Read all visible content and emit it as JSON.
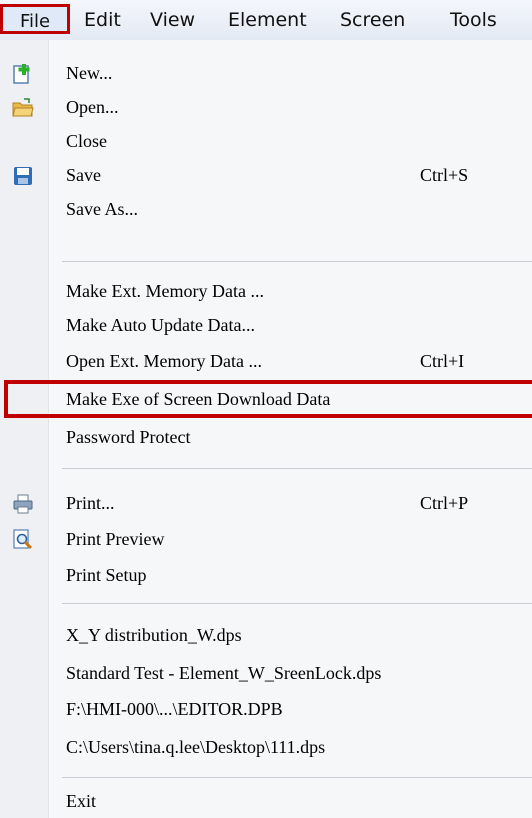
{
  "menubar": {
    "items": [
      {
        "label": "File"
      },
      {
        "label": "Edit"
      },
      {
        "label": "View"
      },
      {
        "label": "Element"
      },
      {
        "label": "Screen"
      },
      {
        "label": "Tools"
      }
    ]
  },
  "menu": {
    "items": [
      {
        "label": "New...",
        "shortcut": "",
        "icon": "new-file-icon"
      },
      {
        "label": "Open...",
        "shortcut": "",
        "icon": "open-folder-icon"
      },
      {
        "label": "Close",
        "shortcut": ""
      },
      {
        "label": "Save",
        "shortcut": "Ctrl+S",
        "icon": "save-icon"
      },
      {
        "label": "Save As...",
        "shortcut": ""
      },
      {
        "label": "Make Ext. Memory Data ...",
        "shortcut": ""
      },
      {
        "label": "Make Auto Update Data...",
        "shortcut": ""
      },
      {
        "label": "Open Ext. Memory Data ...",
        "shortcut": "Ctrl+I"
      },
      {
        "label": "Make Exe of Screen Download Data",
        "shortcut": ""
      },
      {
        "label": "Password Protect",
        "shortcut": ""
      },
      {
        "label": "Print...",
        "shortcut": "Ctrl+P",
        "icon": "printer-icon"
      },
      {
        "label": "Print Preview",
        "shortcut": "",
        "icon": "print-preview-icon"
      },
      {
        "label": "Print Setup",
        "shortcut": ""
      },
      {
        "label": "X_Y distribution_W.dps",
        "shortcut": ""
      },
      {
        "label": "Standard Test - Element_W_SreenLock.dps",
        "shortcut": ""
      },
      {
        "label": "F:\\HMI-000\\...\\EDITOR.DPB",
        "shortcut": ""
      },
      {
        "label": "C:\\Users\\tina.q.lee\\Desktop\\111.dps",
        "shortcut": ""
      },
      {
        "label": "Exit",
        "shortcut": ""
      }
    ]
  },
  "colors": {
    "highlight_border": "#c00000",
    "menu_background": "#f6f7f9",
    "menubar_background": "#e8edf5"
  }
}
